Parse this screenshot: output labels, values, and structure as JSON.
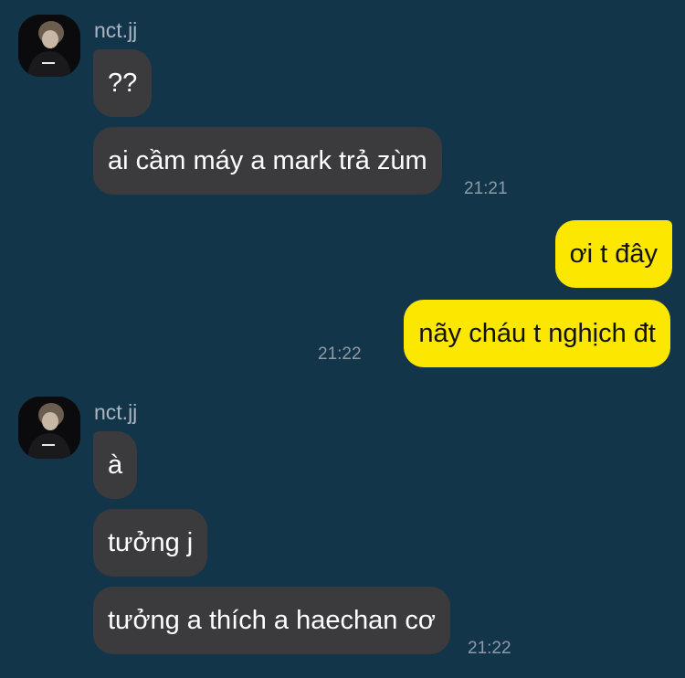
{
  "conversation": {
    "groups": [
      {
        "sender": "nct.jj",
        "messages": [
          "??",
          "ai cầm máy a mark trả zùm"
        ],
        "time": "21:21"
      },
      {
        "sender": "me",
        "messages": [
          "ơi t đây",
          "nãy cháu t nghịch đt"
        ],
        "time": "21:22"
      },
      {
        "sender": "nct.jj",
        "messages": [
          "à",
          "tưởng j",
          "tưởng a thích a haechan cơ"
        ],
        "time": "21:22"
      }
    ]
  },
  "icons": {
    "avatar": "profile-photo"
  },
  "colors": {
    "background": "#13354a",
    "incoming_bubble": "#3b3b3e",
    "outgoing_bubble": "#fce700",
    "timestamp": "#8e9aa5"
  }
}
